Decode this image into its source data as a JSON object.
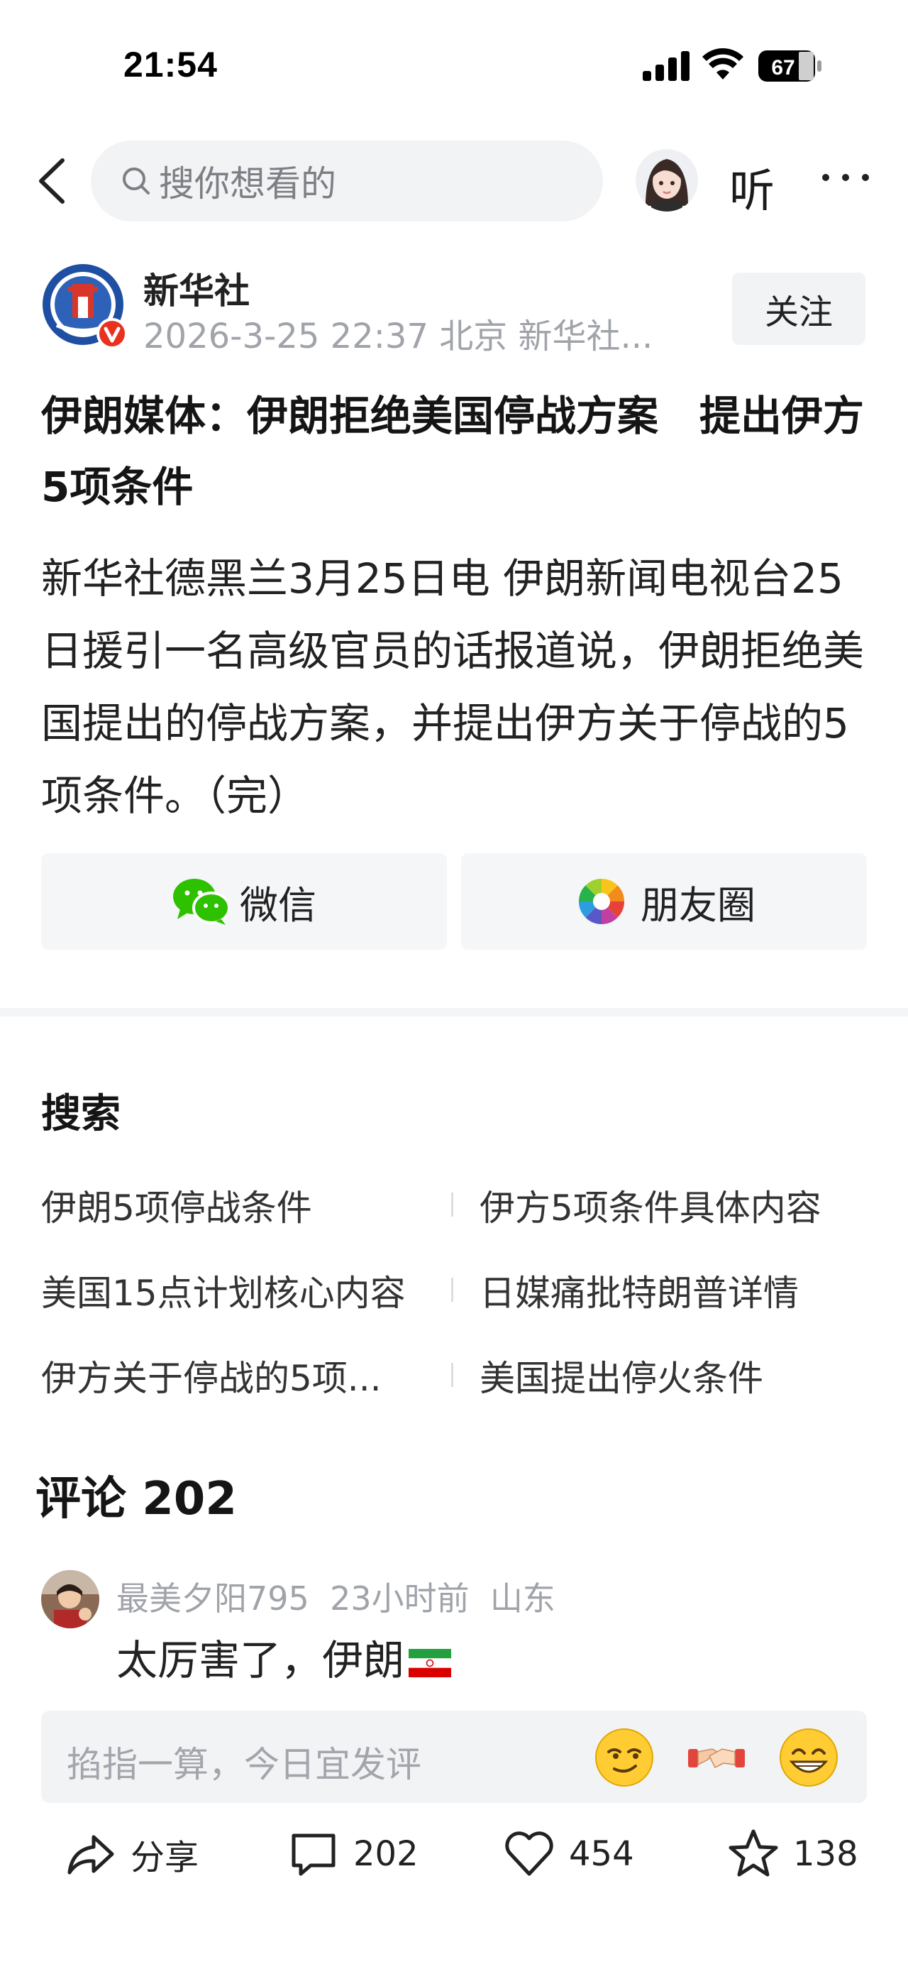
{
  "status_bar": {
    "time": "21:54",
    "battery": "67"
  },
  "nav": {
    "search_placeholder": "搜你想看的",
    "listen_label": "听"
  },
  "author": {
    "name": "新华社",
    "meta": "2026-3-25 22:37 北京 新华社...",
    "follow_label": "关注"
  },
  "article": {
    "title": "伊朗媒体：伊朗拒绝美国停战方案　提出伊方5项条件",
    "body": "新华社德黑兰3月25日电 伊朗新闻电视台25日援引一名高级官员的话报道说，伊朗拒绝美国提出的停战方案，并提出伊方关于停战的5项条件。（完）"
  },
  "share": {
    "wechat_label": "微信",
    "moments_label": "朋友圈"
  },
  "related_search": {
    "title": "搜索",
    "items": [
      "伊朗5项停战条件",
      "伊方5项条件具体内容",
      "美国15点计划核心内容",
      "日媒痛批特朗普详情",
      "伊方关于停战的5项...",
      "美国提出停火条件"
    ]
  },
  "comments": {
    "title": "评论 202",
    "items": [
      {
        "user": "最美夕阳795",
        "time": "23小时前",
        "location": "山东",
        "text": "太厉害了，伊朗"
      }
    ],
    "input_placeholder": "掐指一算，今日宜发评"
  },
  "bottom_bar": {
    "share_label": "分享",
    "comment_count": "202",
    "like_count": "454",
    "favorite_count": "138"
  },
  "colors": {
    "verified_badge": "#e8321e",
    "text_secondary": "#a0a3a9",
    "surface": "#f2f3f5"
  }
}
